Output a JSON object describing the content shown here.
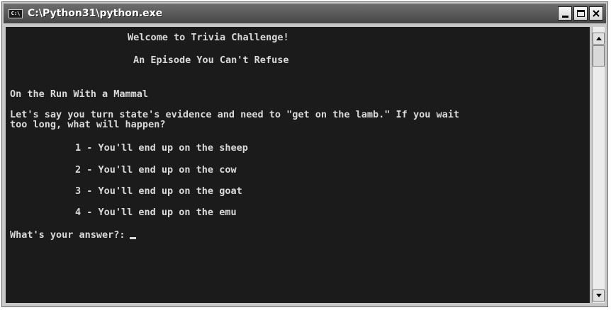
{
  "window": {
    "title": "C:\\Python31\\python.exe",
    "icon_name": "console-icon",
    "icon_text": "C:\\"
  },
  "console": {
    "welcome": "Welcome to Trivia Challenge!",
    "episode": "An Episode You Can't Refuse",
    "category": "On the Run With a Mammal",
    "question_line1": "Let's say you turn state's evidence and need to \"get on the lamb.\" If you wait",
    "question_line2": "too long, what will happen?",
    "answers": [
      "1 - You'll end up on the sheep",
      "2 - You'll end up on the cow",
      "3 - You'll end up on the goat",
      "4 - You'll end up on the emu"
    ],
    "prompt": "What's your answer?:"
  },
  "colors": {
    "console_background": "#1b1b1b",
    "console_text": "#dadada",
    "titlebar": "#555555"
  }
}
